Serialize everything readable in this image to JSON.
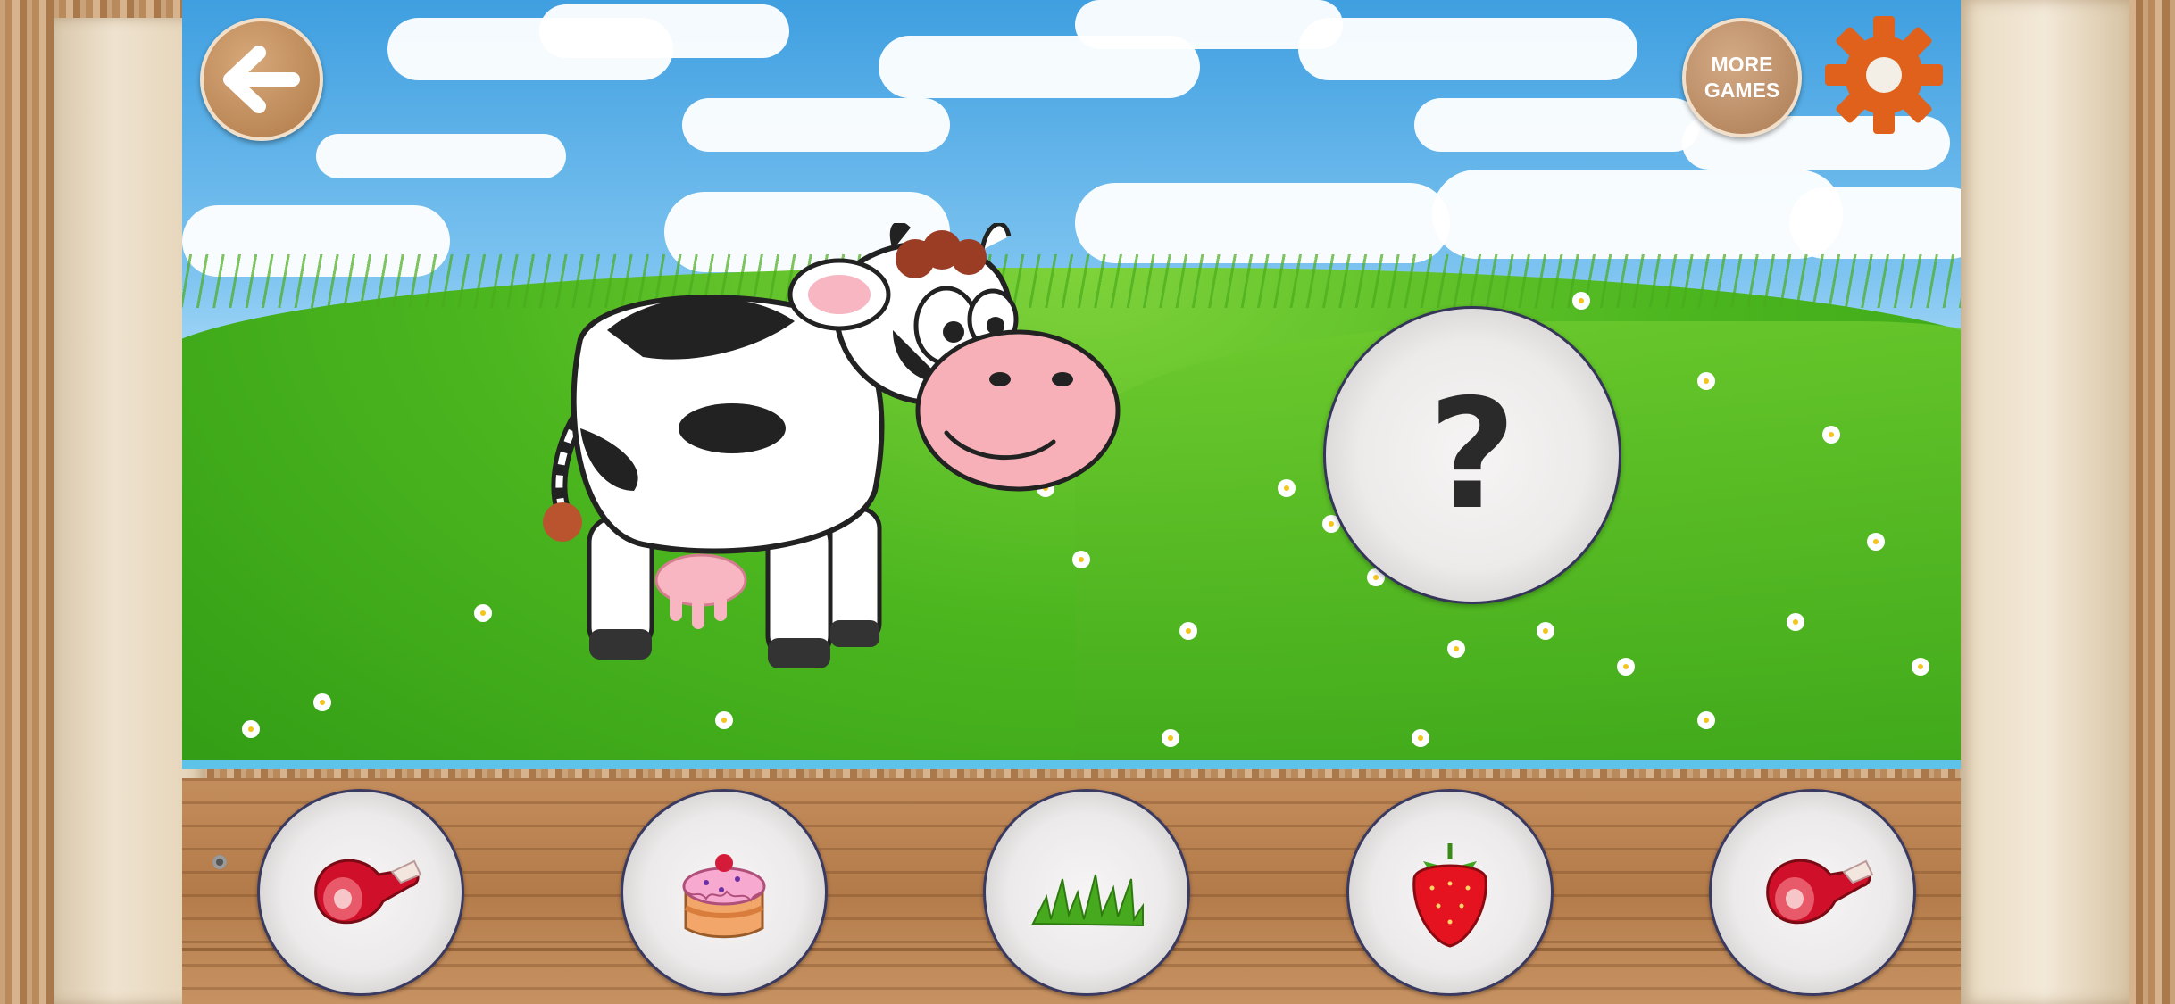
{
  "buttons": {
    "back": "back-arrow",
    "more_games_label": "MORE\nGAMES",
    "settings": "gear"
  },
  "target_slot": {
    "label": "?"
  },
  "character": "cow",
  "food_options": [
    {
      "item": "meat-icon"
    },
    {
      "item": "cake-icon"
    },
    {
      "item": "grass-icon"
    },
    {
      "item": "strawberry-icon"
    },
    {
      "item": "meat-icon"
    }
  ],
  "colors": {
    "gear": "#e0611c",
    "plate_border": "#3a3a60",
    "sky": "#7cc3f0",
    "grass": "#4cb61f"
  }
}
